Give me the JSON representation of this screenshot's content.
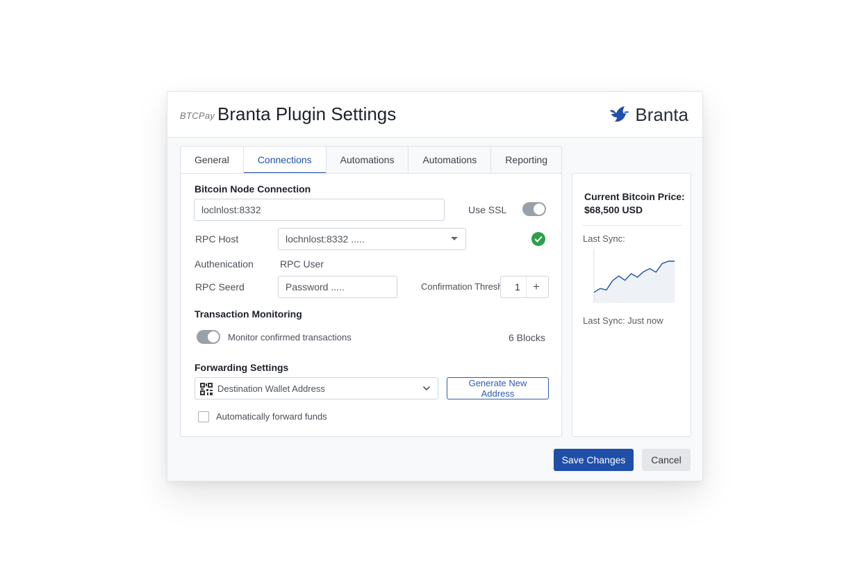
{
  "header": {
    "app_logo_text": "BTCPay",
    "title": "Branta Plugin Settings",
    "brand_name": "Branta"
  },
  "tabs": [
    {
      "label": "General",
      "active": false
    },
    {
      "label": "Connections",
      "active": true
    },
    {
      "label": "Automations",
      "active": false
    },
    {
      "label": "Automations",
      "active": false
    },
    {
      "label": "Reporting",
      "active": false
    }
  ],
  "node_connection": {
    "section_title": "Bitcoin Node Connection",
    "host_value": "loclnlost:8332",
    "use_ssl_label": "Use SSL",
    "use_ssl_enabled": true,
    "rpc_host_label": "RPC Host",
    "rpc_host_value": "lochnlost:8332 .....",
    "authentication_label": "Authenication",
    "rpc_user_label": "RPC User",
    "rpc_secret_label": "RPC Seerd",
    "password_placeholder": "Password .....",
    "confirmation_threshold_label": "Confirmation Threshold",
    "confirmation_threshold_value": "1",
    "stepper_plus": "+"
  },
  "transaction_monitoring": {
    "section_title": "Transaction Monitoring",
    "monitor_label": "Monitor confirmed transactions",
    "monitor_enabled": true,
    "blocks_text": "6 Blocks"
  },
  "forwarding": {
    "section_title": "Forwarding Settings",
    "destination_placeholder": "Destination Wallet Address",
    "generate_button": "Generate New Address",
    "auto_forward_label": "Automatically forward funds",
    "auto_forward_checked": false
  },
  "side_panel": {
    "price_title": "Current Bitcoin Price:",
    "price_value": "$68,500 USD",
    "last_sync_label": "Last Sync:",
    "last_sync_status": "Last Sync: Just now",
    "sparkline_values": [
      2,
      3,
      2.6,
      5,
      6.2,
      5.1,
      6.8,
      5.9,
      7.3,
      8.1,
      7.2,
      9.4,
      10,
      10
    ]
  },
  "footer": {
    "save_label": "Save Changes",
    "cancel_label": "Cancel"
  },
  "colors": {
    "primary": "#1f4fa8",
    "success": "#2e9e4b",
    "brand_bird": "#1f4fa8"
  }
}
